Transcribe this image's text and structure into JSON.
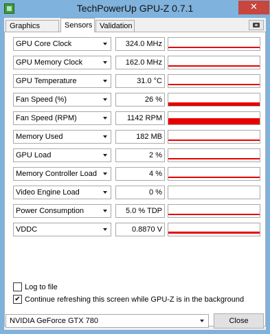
{
  "window": {
    "title": "TechPowerUp GPU-Z 0.7.1",
    "close_glyph": "✕"
  },
  "tabs": [
    {
      "label": "Graphics Card",
      "active": false
    },
    {
      "label": "Sensors",
      "active": true
    },
    {
      "label": "Validation",
      "active": false
    }
  ],
  "toolbar": {
    "screenshot_icon": "camera-icon"
  },
  "sensors": [
    {
      "name": "GPU Core Clock",
      "value": "324.0 MHz",
      "graph_level": 0.08
    },
    {
      "name": "GPU Memory Clock",
      "value": "162.0 MHz",
      "graph_level": 0.02
    },
    {
      "name": "GPU Temperature",
      "value": "31.0 °C",
      "graph_level": 0.06
    },
    {
      "name": "Fan Speed (%)",
      "value": "26 %",
      "graph_level": 0.26
    },
    {
      "name": "Fan Speed (RPM)",
      "value": "1142 RPM",
      "graph_level": 0.5
    },
    {
      "name": "Memory Used",
      "value": "182 MB",
      "graph_level": 0.04
    },
    {
      "name": "GPU Load",
      "value": "2 %",
      "graph_level": 0.02
    },
    {
      "name": "Memory Controller Load",
      "value": "4 %",
      "graph_level": 0.04
    },
    {
      "name": "Video Engine Load",
      "value": "0 %",
      "graph_level": 0.0
    },
    {
      "name": "Power Consumption",
      "value": "5.0 % TDP",
      "graph_level": 0.05
    },
    {
      "name": "VDDC",
      "value": "0.8870 V",
      "graph_level": 0.15
    }
  ],
  "options": {
    "log_to_file": {
      "label": "Log to file",
      "checked": false
    },
    "continue_refresh": {
      "label": "Continue refreshing this screen while GPU-Z is in the background",
      "checked": true
    },
    "check_glyph": "✔"
  },
  "footer": {
    "gpu_select_value": "NVIDIA GeForce GTX 780",
    "close_label": "Close"
  },
  "colors": {
    "graph": "#e60000",
    "title_bar": "#7fb2dc",
    "close_button": "#c7463d"
  }
}
